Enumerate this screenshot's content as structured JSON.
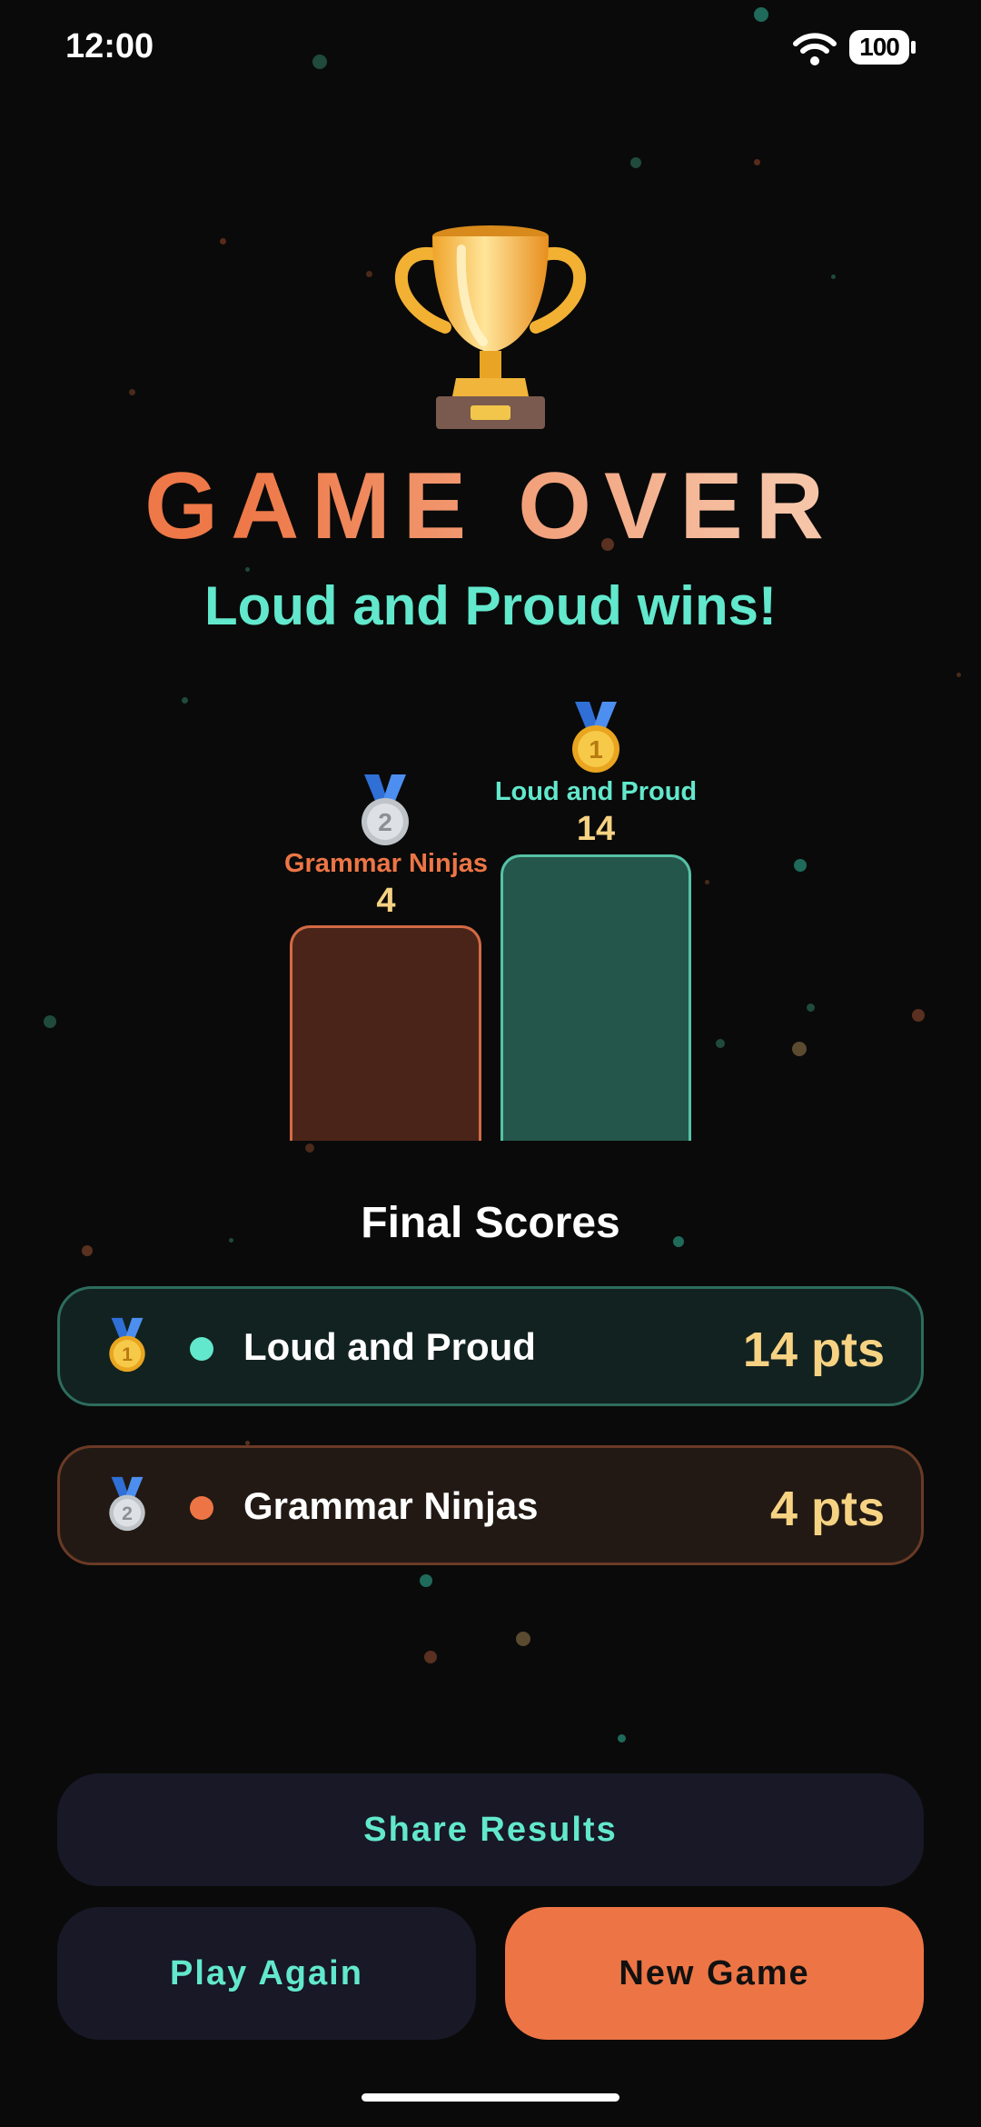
{
  "status_bar": {
    "time": "12:00",
    "battery": "100"
  },
  "header": {
    "title": "GAME OVER",
    "winner_message": "Loud and Proud wins!"
  },
  "podium": {
    "second": {
      "team": "Grammar Ninjas",
      "score": "4",
      "rank": "2"
    },
    "first": {
      "team": "Loud and Proud",
      "score": "14",
      "rank": "1"
    }
  },
  "final_scores": {
    "title": "Final Scores",
    "rows": [
      {
        "rank": "1",
        "team": "Loud and Proud",
        "points": "14 pts",
        "color": "#62e8cc"
      },
      {
        "rank": "2",
        "team": "Grammar Ninjas",
        "points": "4 pts",
        "color": "#ed7545"
      }
    ]
  },
  "buttons": {
    "share": "Share Results",
    "play_again": "Play Again",
    "new_game": "New Game"
  },
  "colors": {
    "accent_teal": "#62e8cc",
    "accent_orange": "#ed7545",
    "score_gold": "#f6d283",
    "background": "#0a0a0a"
  }
}
